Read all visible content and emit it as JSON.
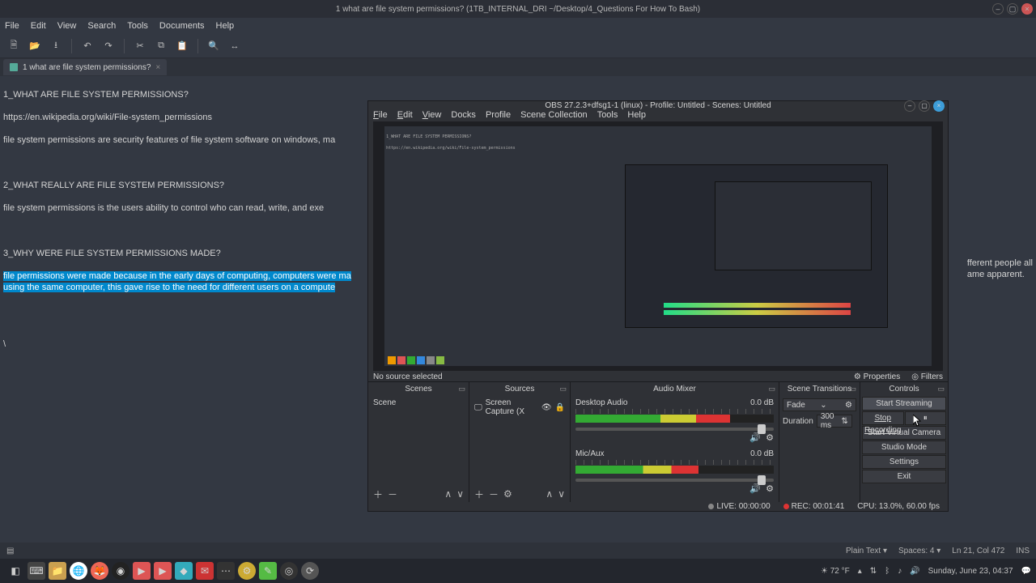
{
  "desktop": {
    "title": "1 what are file system permissions? (1TB_INTERNAL_DRI ~/Desktop/4_Questions For How To Bash)"
  },
  "editor": {
    "menu": [
      "File",
      "Edit",
      "View",
      "Search",
      "Tools",
      "Documents",
      "Help"
    ],
    "tab": {
      "name": "1 what are file system permissions?",
      "close": "×"
    },
    "lines": {
      "l1": "1_WHAT ARE FILE SYSTEM PERMISSIONS?",
      "l2": "https://en.wikipedia.org/wiki/File-system_permissions",
      "l3": "file system permissions are security features of file system software on windows, ma",
      "l4": "2_WHAT REALLY ARE FILE SYSTEM PERMISSIONS?",
      "l5": "file system permissions is the users ability to control who can read, write, and exe",
      "l6": "3_WHY WERE FILE SYSTEM PERMISSIONS MADE?",
      "l7a": "file permissions were made because in the early days of computing, computers were ma",
      "l7b": "using the same computer, this gave rise to the need for different users on a compute",
      "l7c": "fferent people all",
      "l7d": "ame apparent.",
      "l8": "\\"
    },
    "status": {
      "plain": "Plain Text ▾",
      "spaces": "Spaces: 4 ▾",
      "pos": "Ln 21, Col 472",
      "ins": "INS"
    }
  },
  "obs": {
    "title": "OBS 27.2.3+dfsg1-1 (linux) - Profile: Untitled - Scenes: Untitled",
    "menu": {
      "file": "File",
      "edit": "Edit",
      "view": "View",
      "docks": "Docks",
      "profile": "Profile",
      "scenecol": "Scene Collection",
      "tools": "Tools",
      "help": "Help"
    },
    "row": {
      "nosrc": "No source selected",
      "props": "Properties",
      "filters": "Filters"
    },
    "scenes": {
      "title": "Scenes",
      "items": [
        "Scene"
      ]
    },
    "sources": {
      "title": "Sources",
      "items": [
        {
          "name": "Screen Capture (X"
        }
      ]
    },
    "mixer": {
      "title": "Audio Mixer",
      "channels": [
        {
          "name": "Desktop Audio",
          "db": "0.0 dB",
          "level": 92
        },
        {
          "name": "Mic/Aux",
          "db": "0.0 dB",
          "level": 92
        }
      ]
    },
    "transitions": {
      "title": "Scene Transitions",
      "sel": "Fade",
      "dur_label": "Duration",
      "dur_val": "300 ms"
    },
    "controls": {
      "title": "Controls",
      "start_stream": "Start Streaming",
      "stop_rec": "Stop Recording",
      "virtual_cam": "Start Virtual Camera",
      "studio": "Studio Mode",
      "settings": "Settings",
      "exit": "Exit"
    },
    "status": {
      "live": "LIVE: 00:00:00",
      "rec": "REC: 00:01:41",
      "cpu": "CPU: 13.0%, 60.00 fps"
    }
  },
  "taskbar": {
    "temp": "72 °F",
    "date": "Sunday, June 23, 04:37"
  }
}
